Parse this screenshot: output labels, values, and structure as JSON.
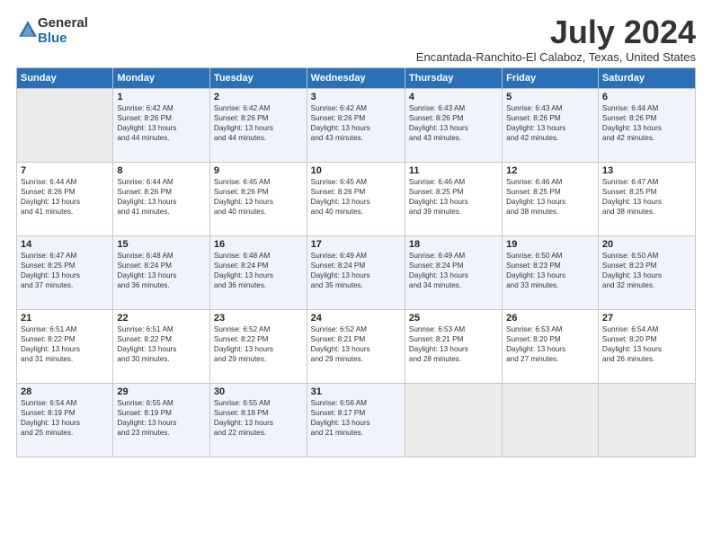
{
  "logo": {
    "text_general": "General",
    "text_blue": "Blue"
  },
  "header": {
    "month_year": "July 2024",
    "location": "Encantada-Ranchito-El Calaboz, Texas, United States"
  },
  "weekdays": [
    "Sunday",
    "Monday",
    "Tuesday",
    "Wednesday",
    "Thursday",
    "Friday",
    "Saturday"
  ],
  "weeks": [
    [
      {
        "day": "",
        "info": ""
      },
      {
        "day": "1",
        "info": "Sunrise: 6:42 AM\nSunset: 8:26 PM\nDaylight: 13 hours\nand 44 minutes."
      },
      {
        "day": "2",
        "info": "Sunrise: 6:42 AM\nSunset: 8:26 PM\nDaylight: 13 hours\nand 44 minutes."
      },
      {
        "day": "3",
        "info": "Sunrise: 6:42 AM\nSunset: 8:26 PM\nDaylight: 13 hours\nand 43 minutes."
      },
      {
        "day": "4",
        "info": "Sunrise: 6:43 AM\nSunset: 8:26 PM\nDaylight: 13 hours\nand 43 minutes."
      },
      {
        "day": "5",
        "info": "Sunrise: 6:43 AM\nSunset: 8:26 PM\nDaylight: 13 hours\nand 42 minutes."
      },
      {
        "day": "6",
        "info": "Sunrise: 6:44 AM\nSunset: 8:26 PM\nDaylight: 13 hours\nand 42 minutes."
      }
    ],
    [
      {
        "day": "7",
        "info": "Sunrise: 6:44 AM\nSunset: 8:26 PM\nDaylight: 13 hours\nand 41 minutes."
      },
      {
        "day": "8",
        "info": "Sunrise: 6:44 AM\nSunset: 8:26 PM\nDaylight: 13 hours\nand 41 minutes."
      },
      {
        "day": "9",
        "info": "Sunrise: 6:45 AM\nSunset: 8:26 PM\nDaylight: 13 hours\nand 40 minutes."
      },
      {
        "day": "10",
        "info": "Sunrise: 6:45 AM\nSunset: 8:26 PM\nDaylight: 13 hours\nand 40 minutes."
      },
      {
        "day": "11",
        "info": "Sunrise: 6:46 AM\nSunset: 8:25 PM\nDaylight: 13 hours\nand 39 minutes."
      },
      {
        "day": "12",
        "info": "Sunrise: 6:46 AM\nSunset: 8:25 PM\nDaylight: 13 hours\nand 38 minutes."
      },
      {
        "day": "13",
        "info": "Sunrise: 6:47 AM\nSunset: 8:25 PM\nDaylight: 13 hours\nand 38 minutes."
      }
    ],
    [
      {
        "day": "14",
        "info": "Sunrise: 6:47 AM\nSunset: 8:25 PM\nDaylight: 13 hours\nand 37 minutes."
      },
      {
        "day": "15",
        "info": "Sunrise: 6:48 AM\nSunset: 8:24 PM\nDaylight: 13 hours\nand 36 minutes."
      },
      {
        "day": "16",
        "info": "Sunrise: 6:48 AM\nSunset: 8:24 PM\nDaylight: 13 hours\nand 36 minutes."
      },
      {
        "day": "17",
        "info": "Sunrise: 6:49 AM\nSunset: 8:24 PM\nDaylight: 13 hours\nand 35 minutes."
      },
      {
        "day": "18",
        "info": "Sunrise: 6:49 AM\nSunset: 8:24 PM\nDaylight: 13 hours\nand 34 minutes."
      },
      {
        "day": "19",
        "info": "Sunrise: 6:50 AM\nSunset: 8:23 PM\nDaylight: 13 hours\nand 33 minutes."
      },
      {
        "day": "20",
        "info": "Sunrise: 6:50 AM\nSunset: 8:23 PM\nDaylight: 13 hours\nand 32 minutes."
      }
    ],
    [
      {
        "day": "21",
        "info": "Sunrise: 6:51 AM\nSunset: 8:22 PM\nDaylight: 13 hours\nand 31 minutes."
      },
      {
        "day": "22",
        "info": "Sunrise: 6:51 AM\nSunset: 8:22 PM\nDaylight: 13 hours\nand 30 minutes."
      },
      {
        "day": "23",
        "info": "Sunrise: 6:52 AM\nSunset: 8:22 PM\nDaylight: 13 hours\nand 29 minutes."
      },
      {
        "day": "24",
        "info": "Sunrise: 6:52 AM\nSunset: 8:21 PM\nDaylight: 13 hours\nand 29 minutes."
      },
      {
        "day": "25",
        "info": "Sunrise: 6:53 AM\nSunset: 8:21 PM\nDaylight: 13 hours\nand 28 minutes."
      },
      {
        "day": "26",
        "info": "Sunrise: 6:53 AM\nSunset: 8:20 PM\nDaylight: 13 hours\nand 27 minutes."
      },
      {
        "day": "27",
        "info": "Sunrise: 6:54 AM\nSunset: 8:20 PM\nDaylight: 13 hours\nand 26 minutes."
      }
    ],
    [
      {
        "day": "28",
        "info": "Sunrise: 6:54 AM\nSunset: 8:19 PM\nDaylight: 13 hours\nand 25 minutes."
      },
      {
        "day": "29",
        "info": "Sunrise: 6:55 AM\nSunset: 8:19 PM\nDaylight: 13 hours\nand 23 minutes."
      },
      {
        "day": "30",
        "info": "Sunrise: 6:55 AM\nSunset: 8:18 PM\nDaylight: 13 hours\nand 22 minutes."
      },
      {
        "day": "31",
        "info": "Sunrise: 6:56 AM\nSunset: 8:17 PM\nDaylight: 13 hours\nand 21 minutes."
      },
      {
        "day": "",
        "info": ""
      },
      {
        "day": "",
        "info": ""
      },
      {
        "day": "",
        "info": ""
      }
    ]
  ]
}
